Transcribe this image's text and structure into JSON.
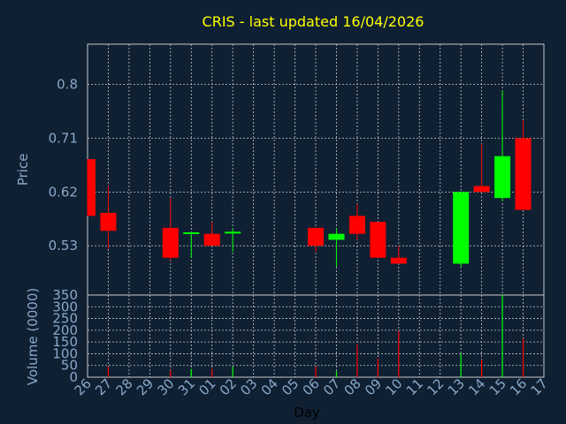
{
  "chart_data": {
    "type": "candlestick",
    "title": "CRIS - last updated 16/04/2026",
    "xlabel": "Day",
    "ylabel_price": "Price",
    "ylabel_volume": "Volume (0000)",
    "x_ticks": [
      "26",
      "27",
      "28",
      "29",
      "30",
      "31",
      "01",
      "02",
      "03",
      "04",
      "05",
      "06",
      "07",
      "08",
      "09",
      "10",
      "11",
      "12",
      "13",
      "14",
      "15",
      "16",
      "17"
    ],
    "price_ticks": [
      0.8,
      0.71,
      0.62,
      0.53
    ],
    "price_tick_labels": [
      "0.8",
      "0.71",
      "0.62",
      "0.53"
    ],
    "price_range": [
      0.4475,
      0.8675
    ],
    "volume_ticks": [
      0,
      50,
      100,
      150,
      200,
      250,
      300,
      350
    ],
    "volume_range": [
      0,
      350
    ],
    "up_color": "#00ff00",
    "down_color": "#ff0000",
    "candles": [
      {
        "day": "26",
        "open": 0.675,
        "high": 0.675,
        "low": 0.58,
        "close": 0.58
      },
      {
        "day": "27",
        "open": 0.585,
        "high": 0.63,
        "low": 0.525,
        "close": 0.555
      },
      {
        "day": "30",
        "open": 0.56,
        "high": 0.61,
        "low": 0.505,
        "close": 0.51
      },
      {
        "day": "31",
        "open": 0.55,
        "high": 0.55,
        "low": 0.51,
        "close": 0.551
      },
      {
        "day": "01",
        "open": 0.55,
        "high": 0.57,
        "low": 0.53,
        "close": 0.53
      },
      {
        "day": "02",
        "open": 0.55,
        "high": 0.56,
        "low": 0.52,
        "close": 0.552
      },
      {
        "day": "06",
        "open": 0.56,
        "high": 0.56,
        "low": 0.52,
        "close": 0.53
      },
      {
        "day": "07",
        "open": 0.54,
        "high": 0.56,
        "low": 0.495,
        "close": 0.55
      },
      {
        "day": "08",
        "open": 0.58,
        "high": 0.6,
        "low": 0.54,
        "close": 0.55
      },
      {
        "day": "09",
        "open": 0.57,
        "high": 0.57,
        "low": 0.51,
        "close": 0.51
      },
      {
        "day": "10",
        "open": 0.51,
        "high": 0.53,
        "low": 0.5,
        "close": 0.5
      },
      {
        "day": "13",
        "open": 0.5,
        "high": 0.62,
        "low": 0.495,
        "close": 0.62
      },
      {
        "day": "14",
        "open": 0.63,
        "high": 0.7,
        "low": 0.62,
        "close": 0.62
      },
      {
        "day": "15",
        "open": 0.61,
        "high": 0.79,
        "low": 0.605,
        "close": 0.68
      },
      {
        "day": "16",
        "open": 0.71,
        "high": 0.74,
        "low": 0.59,
        "close": 0.59
      }
    ],
    "volume": [
      {
        "day": "27",
        "value": 45,
        "color": "#ff0000"
      },
      {
        "day": "30",
        "value": 30,
        "color": "#ff0000"
      },
      {
        "day": "31",
        "value": 35,
        "color": "#00ff00"
      },
      {
        "day": "01",
        "value": 35,
        "color": "#ff0000"
      },
      {
        "day": "02",
        "value": 45,
        "color": "#00ff00"
      },
      {
        "day": "06",
        "value": 45,
        "color": "#ff0000"
      },
      {
        "day": "07",
        "value": 25,
        "color": "#00ff00"
      },
      {
        "day": "08",
        "value": 140,
        "color": "#ff0000"
      },
      {
        "day": "09",
        "value": 80,
        "color": "#ff0000"
      },
      {
        "day": "10",
        "value": 195,
        "color": "#ff0000"
      },
      {
        "day": "13",
        "value": 100,
        "color": "#00ff00"
      },
      {
        "day": "14",
        "value": 75,
        "color": "#ff0000"
      },
      {
        "day": "15",
        "value": 350,
        "color": "#00ff00"
      },
      {
        "day": "16",
        "value": 165,
        "color": "#ff0000"
      }
    ]
  }
}
